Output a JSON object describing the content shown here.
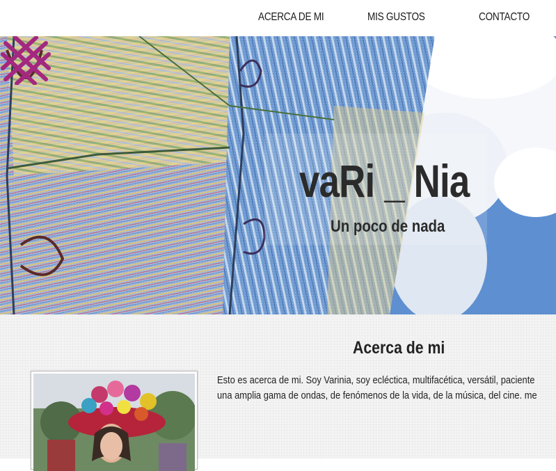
{
  "nav": {
    "items": [
      {
        "label": "ACERCA DE MI"
      },
      {
        "label": "MIS GUSTOS"
      },
      {
        "label": "CONTACTO"
      }
    ]
  },
  "header": {
    "title": "vaRi _ Nia",
    "tagline": "Un poco de nada",
    "logo_color": "#a3287f"
  },
  "about": {
    "heading": "Acerca de mi",
    "line1": "Esto es acerca de mi. Soy Varinia, soy ecléctica, multifacética, versátil, paciente",
    "line2": "una amplia gama de ondas, de fenómenos de la vida, de la música, del cine. me"
  },
  "colors": {
    "accent": "#a3287f",
    "text": "#222222"
  }
}
